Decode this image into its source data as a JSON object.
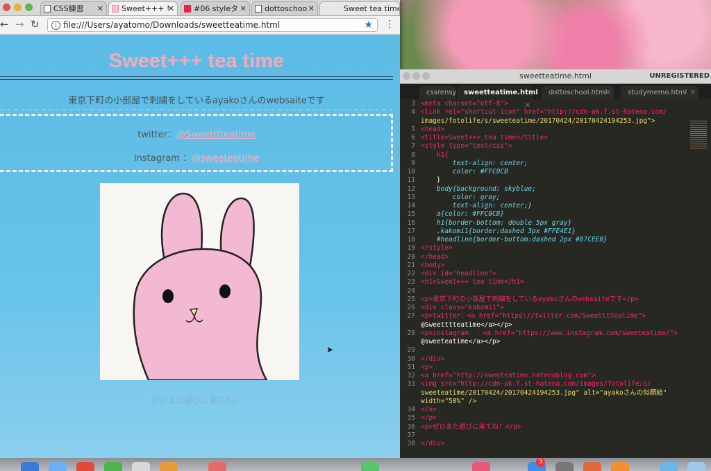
{
  "browser": {
    "tabs": [
      {
        "label": "CSS練習"
      },
      {
        "label": "Sweet+++ !"
      },
      {
        "label": "#06 styleタ"
      },
      {
        "label": "dottoschoo"
      },
      {
        "label": "Sweet tea time"
      }
    ],
    "url": "file:///Users/ayatomo/Downloads/sweetteatime.html"
  },
  "page": {
    "title": "Sweet+++ tea time",
    "tagline": "東京下町の小部屋で刺繍をしているayakoさんのwebsaiteです",
    "twitter_label": "twitter：",
    "twitter_link": "@Sweetttteatime",
    "instagram_label": "instagram ：",
    "instagram_link": "@sweeteatime",
    "footer": "ぜひまた遊びに来てね！"
  },
  "editor": {
    "window_title": "sweetteatime.html",
    "unregistered": "UNREGISTERED",
    "tabs": [
      {
        "label": "cssrensyu"
      },
      {
        "label": "sweetteatime.html"
      },
      {
        "label": "dottoschool.html"
      },
      {
        "label": "studymemo.html"
      }
    ],
    "lines": [
      {
        "n": "3",
        "t": "<meta charset=\"utf-8\">",
        "k": "tag"
      },
      {
        "n": "4",
        "t": "<link rel=\"shortcut icon\" href=\"http://cdn-ak.f.st-hatena.com/",
        "k": "tag"
      },
      {
        "n": "",
        "t": "images/fotolife/s/sweeteatime/20170424/20170424194253.jpg\">",
        "k": "str"
      },
      {
        "n": "5",
        "t": "<head>",
        "k": "tag"
      },
      {
        "n": "6",
        "t": "<title>Sweet+++ tea time</title>",
        "k": "tag"
      },
      {
        "n": "7",
        "t": "<style type=\"text/css\">",
        "k": "tag"
      },
      {
        "n": "8",
        "t": "    h1{",
        "k": "tag"
      },
      {
        "n": "9",
        "t": "        text-align: center;",
        "k": "prop"
      },
      {
        "n": "10",
        "t": "        color: #FFC0CB",
        "k": "prop"
      },
      {
        "n": "11",
        "t": "    }",
        "k": ""
      },
      {
        "n": "12",
        "t": "    body{background: skyblue;",
        "k": "prop"
      },
      {
        "n": "13",
        "t": "        color: gray;",
        "k": "prop"
      },
      {
        "n": "14",
        "t": "        text-align: center;}",
        "k": "prop"
      },
      {
        "n": "15",
        "t": "    a{color: #FFC0CB}",
        "k": "prop"
      },
      {
        "n": "16",
        "t": "    h1{border-bottom: double 5px gray}",
        "k": "prop"
      },
      {
        "n": "17",
        "t": "    .kakomi1{border:dashed 3px #FFE4E1}",
        "k": "prop"
      },
      {
        "n": "18",
        "t": "    #headline{border-bottom:dashed 2px #87CEEB}",
        "k": "prop"
      },
      {
        "n": "19",
        "t": "</style>",
        "k": "tag"
      },
      {
        "n": "20",
        "t": "</head>",
        "k": "tag"
      },
      {
        "n": "21",
        "t": "<body>",
        "k": "tag"
      },
      {
        "n": "22",
        "t": "<div id=\"headline\">",
        "k": "tag"
      },
      {
        "n": "23",
        "t": "<h1>Sweet+++ tea time</h1>",
        "k": "tag"
      },
      {
        "n": "24",
        "t": "",
        "k": ""
      },
      {
        "n": "25",
        "t": "<p>東京下町の小部屋で刺繍をしているayakoさんのwebsaiteです</p>",
        "k": "tag"
      },
      {
        "n": "26",
        "t": "<div class=\"kakomi1\">",
        "k": "tag"
      },
      {
        "n": "27",
        "t": "<p>twitter：<a href=\"https://twitter.com/Sweetttteatime\">",
        "k": "tag"
      },
      {
        "n": "",
        "t": "@Sweetttteatime</a></p>",
        "k": ""
      },
      {
        "n": "28",
        "t": "<p>instagram  ：<a href=\"https://www.instagram.com/sweeteatime/\">",
        "k": "tag"
      },
      {
        "n": "",
        "t": "@sweeteatime</a></p>",
        "k": ""
      },
      {
        "n": "29",
        "t": "",
        "k": ""
      },
      {
        "n": "30",
        "t": "</div>",
        "k": "tag"
      },
      {
        "n": "31",
        "t": "<p>",
        "k": "tag"
      },
      {
        "n": "32",
        "t": "<a href=\"http://sweeteatime.hatenablog.com\">",
        "k": "tag"
      },
      {
        "n": "33",
        "t": "<img src=\"http://cdn-ak.f.st-hatena.com/images/fotolife/s/",
        "k": "tag"
      },
      {
        "n": "",
        "t": "sweeteatime/20170424/20170424194253.jpg\" alt=\"ayakoさんの似顔絵\"",
        "k": "str"
      },
      {
        "n": "",
        "t": "width=\"50%\" />",
        "k": "str"
      },
      {
        "n": "34",
        "t": "</a>",
        "k": "tag"
      },
      {
        "n": "35",
        "t": "</p>",
        "k": "tag"
      },
      {
        "n": "36",
        "t": "<p>ぜひまた遊びに来てね！</p>",
        "k": "tag"
      },
      {
        "n": "37",
        "t": "",
        "k": ""
      },
      {
        "n": "38",
        "t": "</div>",
        "k": "tag"
      }
    ]
  },
  "dock": {
    "badge": "3"
  }
}
